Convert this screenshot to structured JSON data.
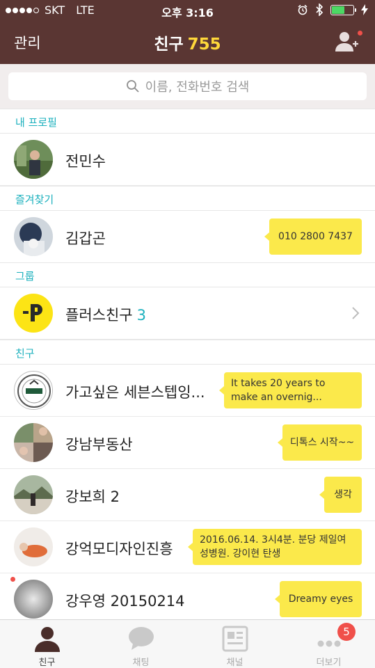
{
  "status_bar": {
    "carrier": "SKT",
    "network": "LTE",
    "time": "오후 3:16",
    "battery_level": 0.55,
    "battery_color": "#4cd964"
  },
  "header": {
    "manage_label": "관리",
    "title": "친구",
    "count": "755",
    "add_friend_icon": "add-friend-icon",
    "count_color": "#ffd83a"
  },
  "search": {
    "placeholder": "이름, 전화번호 검색"
  },
  "sections": {
    "my_profile": "내 프로필",
    "favorites": "즐겨찾기",
    "group": "그룹",
    "friends": "친구"
  },
  "my_profile": {
    "name": "전민수"
  },
  "favorites": [
    {
      "name": "김갑곤",
      "status": "010 2800 7437"
    }
  ],
  "groups": [
    {
      "name": "플러스친구",
      "count": "3",
      "icon": "plus-friend-icon"
    }
  ],
  "friends": [
    {
      "name": "가고싶은 세븐스텝잉...",
      "status": "It takes 20 years to make an overnig..."
    },
    {
      "name": "강남부동산",
      "status": "디톡스 시작~~"
    },
    {
      "name": "강보희 2",
      "status": "생각"
    },
    {
      "name": "강억모디자인진흥",
      "status": "2016.06.14.  3시4분.  분당 제일여성병원. 강이현 탄생"
    },
    {
      "name": "강우영 20150214",
      "status": "Dreamy eyes"
    }
  ],
  "tabs": [
    {
      "label": "친구",
      "icon": "person-icon",
      "active": true
    },
    {
      "label": "채팅",
      "icon": "chat-bubble-icon"
    },
    {
      "label": "채널",
      "icon": "news-icon"
    },
    {
      "label": "더보기",
      "icon": "more-dots-icon",
      "badge": "5"
    }
  ],
  "colors": {
    "header_bg": "#5a3633",
    "accent": "#1bb0bd",
    "bubble": "#fbe94b",
    "badge": "#f0504a"
  }
}
